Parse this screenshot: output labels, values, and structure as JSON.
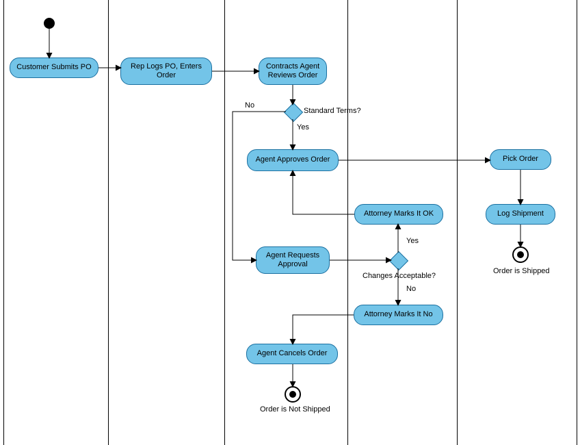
{
  "chart_data": {
    "type": "activity_diagram",
    "swimlanes": [
      {
        "id": "customer",
        "x_range": [
          5,
          158
        ]
      },
      {
        "id": "rep",
        "x_range": [
          158,
          328
        ]
      },
      {
        "id": "agent",
        "x_range": [
          328,
          508
        ]
      },
      {
        "id": "attorney",
        "x_range": [
          508,
          668
        ]
      },
      {
        "id": "fulfillment",
        "x_range": [
          668,
          844
        ]
      }
    ],
    "nodes": {
      "start": {
        "type": "initial"
      },
      "customer_submits": {
        "type": "activity",
        "lane": "customer",
        "label": "Customer Submits PO"
      },
      "rep_logs": {
        "type": "activity",
        "lane": "rep",
        "label": "Rep Logs PO, Enters Order"
      },
      "agent_reviews": {
        "type": "activity",
        "lane": "agent",
        "label": "Contracts Agent Reviews Order"
      },
      "d_standard": {
        "type": "decision",
        "lane": "agent",
        "question": "Standard Terms?"
      },
      "agent_approves": {
        "type": "activity",
        "lane": "agent",
        "label": "Agent Approves Order"
      },
      "agent_requests": {
        "type": "activity",
        "lane": "agent",
        "label": "Agent Requests Approval"
      },
      "d_changes": {
        "type": "decision",
        "lane": "attorney",
        "question": "Changes Acceptable?"
      },
      "attorney_ok": {
        "type": "activity",
        "lane": "attorney",
        "label": "Attorney Marks It OK"
      },
      "attorney_no": {
        "type": "activity",
        "lane": "attorney",
        "label": "Attorney Marks It No"
      },
      "agent_cancels": {
        "type": "activity",
        "lane": "agent",
        "label": "Agent Cancels Order"
      },
      "pick_order": {
        "type": "activity",
        "lane": "fulfillment",
        "label": "Pick Order"
      },
      "log_shipment": {
        "type": "activity",
        "lane": "fulfillment",
        "label": "Log Shipment"
      },
      "end_shipped": {
        "type": "final",
        "lane": "fulfillment",
        "label": "Order is Shipped"
      },
      "end_not_shipped": {
        "type": "final",
        "lane": "agent",
        "label": "Order is Not Shipped"
      }
    },
    "edges": [
      {
        "from": "start",
        "to": "customer_submits"
      },
      {
        "from": "customer_submits",
        "to": "rep_logs"
      },
      {
        "from": "rep_logs",
        "to": "agent_reviews"
      },
      {
        "from": "agent_reviews",
        "to": "d_standard"
      },
      {
        "from": "d_standard",
        "to": "agent_approves",
        "guard": "Yes"
      },
      {
        "from": "d_standard",
        "to": "agent_requests",
        "guard": "No"
      },
      {
        "from": "agent_requests",
        "to": "d_changes"
      },
      {
        "from": "d_changes",
        "to": "attorney_ok",
        "guard": "Yes"
      },
      {
        "from": "d_changes",
        "to": "attorney_no",
        "guard": "No"
      },
      {
        "from": "attorney_ok",
        "to": "agent_approves"
      },
      {
        "from": "attorney_no",
        "to": "agent_cancels"
      },
      {
        "from": "agent_cancels",
        "to": "end_not_shipped"
      },
      {
        "from": "agent_approves",
        "to": "pick_order"
      },
      {
        "from": "pick_order",
        "to": "log_shipment"
      },
      {
        "from": "log_shipment",
        "to": "end_shipped"
      }
    ]
  },
  "labels": {
    "customer_submits": "Customer Submits PO",
    "rep_logs": "Rep Logs PO, Enters Order",
    "agent_reviews": "Contracts Agent Reviews Order",
    "d_standard_q": "Standard Terms?",
    "d_standard_yes": "Yes",
    "d_standard_no": "No",
    "agent_approves": "Agent Approves Order",
    "agent_requests": "Agent Requests Approval",
    "d_changes_q": "Changes Acceptable?",
    "d_changes_yes": "Yes",
    "d_changes_no": "No",
    "attorney_ok": "Attorney Marks It OK",
    "attorney_no": "Attorney Marks It No",
    "agent_cancels": "Agent Cancels Order",
    "pick_order": "Pick Order",
    "log_shipment": "Log Shipment",
    "end_shipped": "Order is Shipped",
    "end_not_shipped": "Order is Not Shipped"
  }
}
